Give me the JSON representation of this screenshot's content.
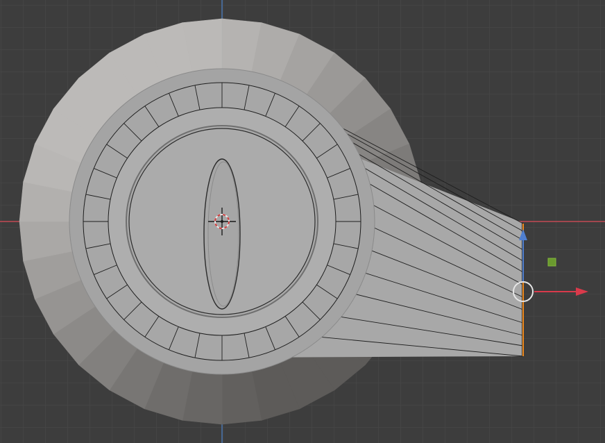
{
  "viewport": {
    "colors": {
      "background": "#3d3d3d",
      "grid_line": "#474747",
      "axis_x": "#c44a55",
      "axis_y": "#4b79b6",
      "mesh_light": "#b9b9b9",
      "mesh_mid": "#a6a6a6",
      "mesh_dark": "#3a3836",
      "edge": "#1d1d1d",
      "selected_edge": "#f08a1c"
    },
    "icons": {
      "cursor": "3d-cursor-icon",
      "gizmo_origin": "gizmo-origin-icon",
      "gizmo_x_arrow": "arrow-right-icon",
      "gizmo_y_arrow": "arrow-up-icon",
      "gizmo_plane": "square-icon"
    }
  }
}
